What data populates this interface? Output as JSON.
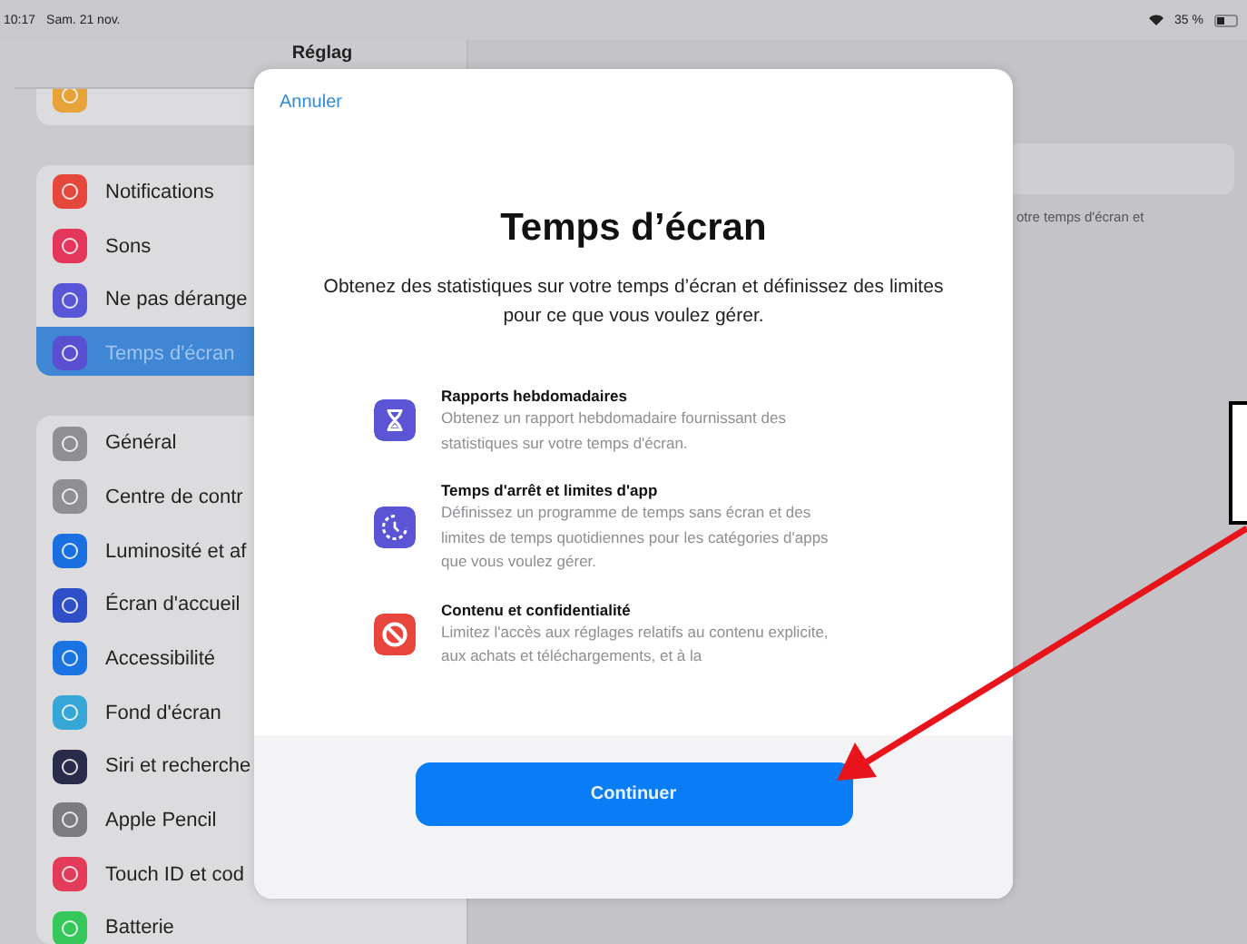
{
  "status_bar": {
    "time": "10:17",
    "date": "Sam. 21 nov.",
    "battery": "35 %"
  },
  "sidebar": {
    "title": "Réglag",
    "groups": [
      {
        "items": [
          {
            "color": "#e7a23a"
          }
        ]
      },
      {
        "items": [
          {
            "label": "Notifications",
            "color": "#e5473d",
            "selected": false
          },
          {
            "label": "Sons",
            "color": "#e3365a",
            "selected": false
          },
          {
            "label": "Ne pas dérange",
            "color": "#5856d6",
            "selected": false
          },
          {
            "label": "Temps d'écran",
            "color": "#5a4fd0",
            "selected": true
          }
        ]
      },
      {
        "items": [
          {
            "label": "Général",
            "color": "#8e8e93",
            "selected": false
          },
          {
            "label": "Centre de contr",
            "color": "#8e8e93",
            "selected": false
          },
          {
            "label": "Luminosité et af",
            "color": "#1a6fe0",
            "selected": false
          },
          {
            "label": "Écran d'accueil",
            "color": "#2f4fc9",
            "selected": false
          },
          {
            "label": "Accessibilité",
            "color": "#1a73e0",
            "selected": false
          },
          {
            "label": "Fond d'écran",
            "color": "#36a6d6",
            "selected": false
          },
          {
            "label": "Siri et recherche",
            "color": "#2a2a4a",
            "selected": false
          },
          {
            "label": "Apple Pencil",
            "color": "#7b7b80",
            "selected": false
          },
          {
            "label": "Touch ID et cod",
            "color": "#e33b5a",
            "selected": false
          },
          {
            "label": "Batterie",
            "color": "#35c759",
            "selected": false
          }
        ]
      }
    ]
  },
  "detail": {
    "text": "otre temps d'écran et"
  },
  "modal": {
    "cancel": "Annuler",
    "title": "Temps d’écran",
    "subtitle": "Obtenez des statistiques sur votre temps d’écran et définissez des limites pour ce que vous voulez gérer.",
    "features": [
      {
        "title": "Rapports hebdomadaires",
        "description": "Obtenez un rapport hebdomadaire fournissant des statistiques sur votre temps d'écran.",
        "color": "#5b55d6"
      },
      {
        "title": "Temps d'arrêt et limites d'app",
        "description": "Définissez un programme de temps sans écran et des limites de temps quotidiennes pour les catégories d'apps que vous voulez gérer.",
        "color": "#5b55d6"
      },
      {
        "title": "Contenu et confidentialité",
        "description": "Limitez l'accès aux réglages relatifs au contenu explicite, aux achats et téléchargements, et à la",
        "color": "#e8453c"
      }
    ],
    "button": "Continuer"
  }
}
